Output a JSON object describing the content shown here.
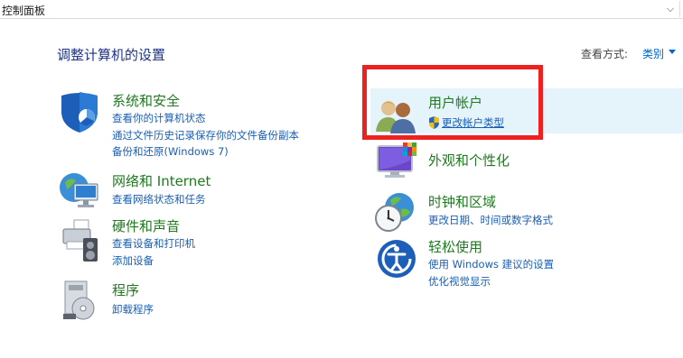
{
  "address": {
    "crumb": "控制面板"
  },
  "header": {
    "title": "调整计算机的设置",
    "view_by_label": "查看方式:",
    "view_by_value": "类别"
  },
  "left": [
    {
      "title": "系统和安全",
      "icon": "shield-icon",
      "links": [
        "查看你的计算机状态",
        "通过文件历史记录保存你的文件备份副本",
        "备份和还原(Windows 7)"
      ]
    },
    {
      "title": "网络和 Internet",
      "icon": "network-globe-icon",
      "links": [
        "查看网络状态和任务"
      ]
    },
    {
      "title": "硬件和声音",
      "icon": "printer-speaker-icon",
      "links": [
        "查看设备和打印机",
        "添加设备"
      ]
    },
    {
      "title": "程序",
      "icon": "programs-disk-icon",
      "links": [
        "卸载程序"
      ]
    }
  ],
  "right": [
    {
      "title": "用户帐户",
      "icon": "users-icon",
      "links": [
        "更改帐户类型"
      ]
    },
    {
      "title": "外观和个性化",
      "icon": "monitor-color-icon",
      "links": []
    },
    {
      "title": "时钟和区域",
      "icon": "clock-globe-icon",
      "links": [
        "更改日期、时间或数字格式"
      ]
    },
    {
      "title": "轻松使用",
      "icon": "ease-of-access-icon",
      "links": [
        "使用 Windows 建议的设置",
        "优化视觉显示"
      ]
    }
  ],
  "colors": {
    "category_title": "#1f7a1f",
    "link": "#1a5fb4",
    "heading": "#1e3287",
    "highlight": "#ee2020",
    "hover": "#e5f3fb"
  }
}
